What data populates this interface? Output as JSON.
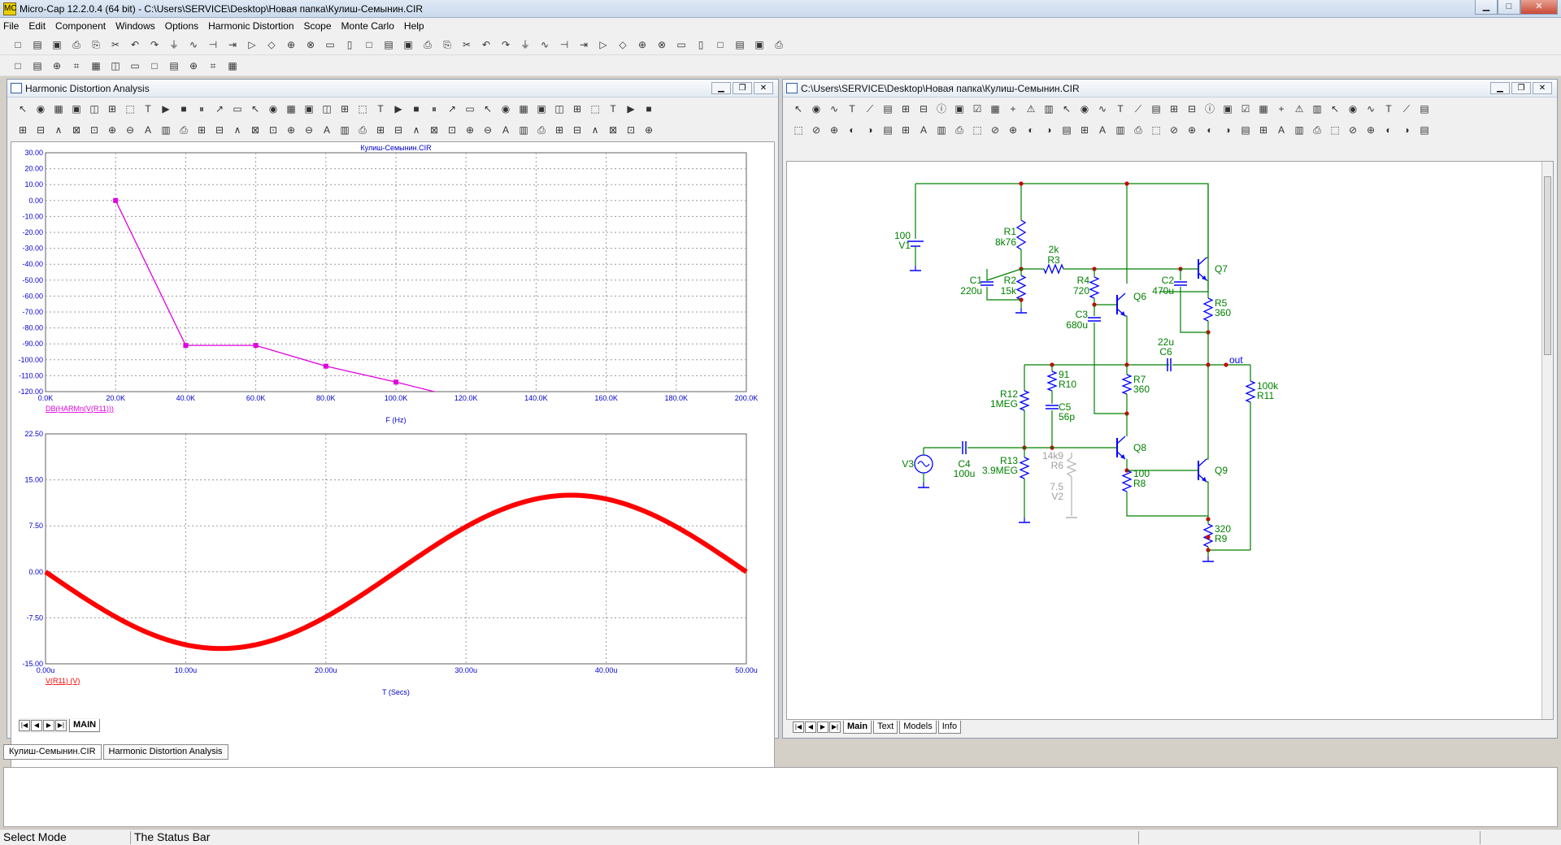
{
  "app": {
    "title": "Micro-Cap 12.2.0.4 (64 bit) - C:\\Users\\SERVICE\\Desktop\\Новая папка\\Кулиш-Семынин.CIR",
    "icon": "MC"
  },
  "menu": [
    "File",
    "Edit",
    "Component",
    "Windows",
    "Options",
    "Harmonic Distortion",
    "Scope",
    "Monte Carlo",
    "Help"
  ],
  "left_panel": {
    "title": "Harmonic Distortion Analysis",
    "sheet_tab": "MAIN"
  },
  "right_panel": {
    "title": "C:\\Users\\SERVICE\\Desktop\\Новая папка\\Кулиш-Семынин.CIR",
    "tabs": [
      "Main",
      "Text",
      "Models",
      "Info"
    ]
  },
  "schematic": {
    "labels": {
      "R1": [
        "R1",
        "8k76"
      ],
      "R2": [
        "R2",
        "15k"
      ],
      "R3": [
        "2k",
        "R3"
      ],
      "R4": [
        "R4",
        "720"
      ],
      "C1": [
        "C1",
        "220u"
      ],
      "C2": [
        "C2",
        "470u"
      ],
      "C3": [
        "C3",
        "680u"
      ],
      "V1": [
        "100",
        "V1"
      ],
      "Q6": "Q6",
      "Q7": "Q7",
      "Q8": "Q8",
      "Q9": "Q9",
      "R5": [
        "R5",
        "360"
      ],
      "R7": [
        "R7",
        "360"
      ],
      "R10": [
        "91",
        "R10"
      ],
      "R12": [
        "R12",
        "1MEG"
      ],
      "C5": [
        "C5",
        "56p"
      ],
      "C6": [
        "22u",
        "C6"
      ],
      "out": "out",
      "R11": [
        "100k",
        "R11"
      ],
      "V3": "V3",
      "C4": [
        "C4",
        "100u"
      ],
      "R13": [
        "R13",
        "3.9MEG"
      ],
      "R6": [
        "14k9",
        "R6"
      ],
      "V2": [
        "7.5",
        "V2"
      ],
      "R8": [
        "100",
        "R8"
      ],
      "R9": [
        "320",
        "R9"
      ]
    }
  },
  "chart_data": [
    {
      "type": "line",
      "title": "Кулиш-Семынин.CIR",
      "xlabel": "F (Hz)",
      "ylabel": "",
      "legend": "DB(HARMn(V(R11)))",
      "xlim": [
        0,
        200000
      ],
      "ylim": [
        -120,
        30
      ],
      "xticks": [
        "0.0K",
        "20.0K",
        "40.0K",
        "60.0K",
        "80.0K",
        "100.0K",
        "120.0K",
        "140.0K",
        "160.0K",
        "180.0K",
        "200.0K"
      ],
      "yticks": [
        "30.00",
        "20.00",
        "10.00",
        "0.00",
        "-10.00",
        "-20.00",
        "-30.00",
        "-40.00",
        "-50.00",
        "-60.00",
        "-70.00",
        "-80.00",
        "-90.00",
        "-100.00",
        "-110.00",
        "-120.00"
      ],
      "series": [
        {
          "name": "DB(HARMn(V(R11)))",
          "color": "#e000e0",
          "x": [
            20000,
            40000,
            60000,
            80000,
            100000,
            120000
          ],
          "y": [
            0,
            -91,
            -91,
            -104,
            -114,
            -125
          ]
        }
      ]
    },
    {
      "type": "line",
      "title": "",
      "xlabel": "T (Secs)",
      "ylabel": "",
      "legend": "V(R11) (V)",
      "xlim": [
        0,
        50
      ],
      "ylim": [
        -15,
        22.5
      ],
      "xticks": [
        "0.00u",
        "10.00u",
        "20.00u",
        "30.00u",
        "40.00u",
        "50.00u"
      ],
      "yticks": [
        "22.50",
        "15.00",
        "7.50",
        "0.00",
        "-7.50",
        "-15.00"
      ],
      "series": [
        {
          "name": "V(R11) (V)",
          "color": "#ff0000",
          "amplitude": 12.5,
          "period_us": 50
        }
      ]
    }
  ],
  "doc_tabs": [
    "Кулиш-Семынин.CIR",
    "Harmonic Distortion Analysis"
  ],
  "status": {
    "mode": "Select Mode",
    "text": "The Status Bar"
  }
}
